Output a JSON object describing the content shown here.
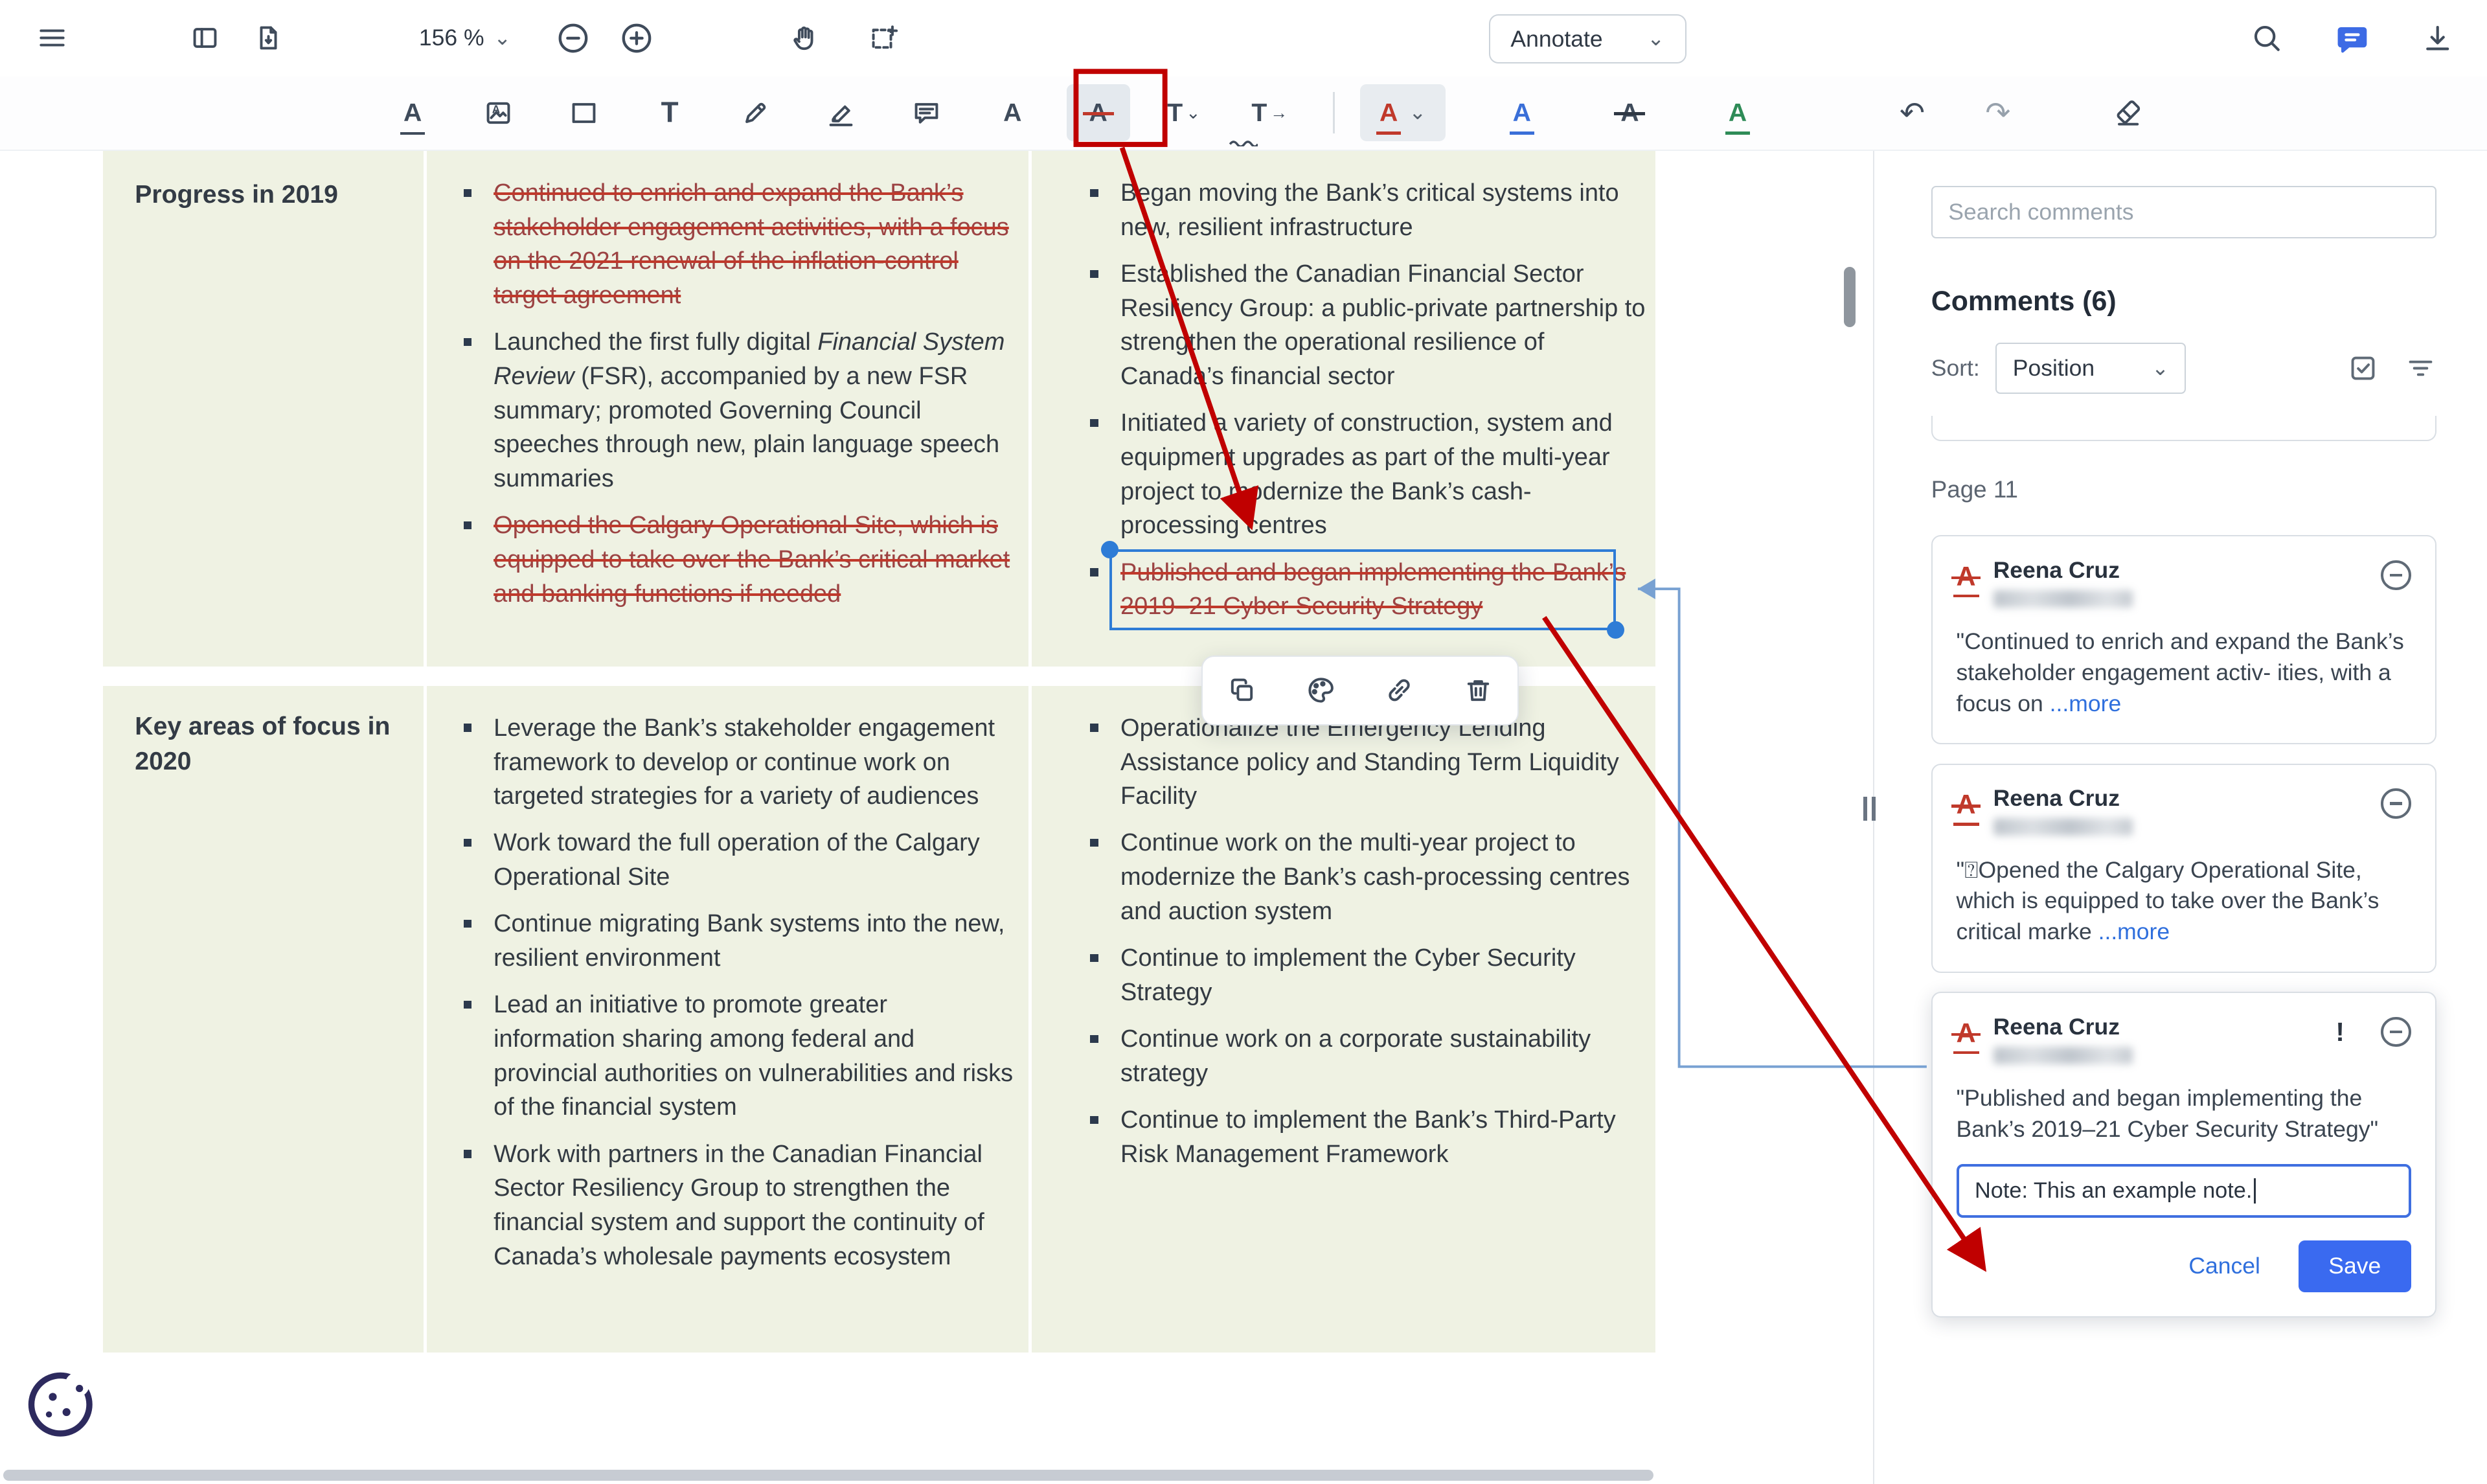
{
  "top_toolbar": {
    "zoom_value": "156 %",
    "annotate_label": "Annotate"
  },
  "glyphs": {
    "chevron": "⌄",
    "undo": "↶",
    "redo": "↷"
  },
  "tools": {
    "underline": "A",
    "text": "T",
    "squiggle": "A",
    "strikeout": "A",
    "insert_text": "T",
    "replace_text": "T",
    "style_red": "A",
    "style_blue": "A",
    "style_black": "A",
    "style_green": "A"
  },
  "doc": {
    "rows": [
      {
        "label": "Progress in 2019",
        "col1": [
          {
            "text": "Continued to enrich and expand the Bank’s stakeholder engagement activities, with a focus on the 2021 renewal of the inflation-control target agreement"
          },
          {
            "pre": "Launched the first fully digital ",
            "italic": "Financial System Review",
            "post": " (FSR), accompanied by a new FSR summary; promoted Governing Council speeches through new, plain language speech summaries"
          },
          {
            "text": "Opened the Calgary Operational Site, which is equipped to take over the Bank’s critical market and banking functions if needed"
          }
        ],
        "col2": [
          {
            "text": "Began moving the Bank’s critical systems into new, resilient infrastructure"
          },
          {
            "text": "Established the Canadian Financial Sector Resiliency Group: a public-private partnership to strengthen the operational resilience of Canada’s financial sector"
          },
          {
            "text": "Initiated a variety of construction, system and equipment upgrades as part of the multi-year project to modernize the Bank’s cash-processing centres"
          },
          {
            "text": "Published and began implementing the Bank’s 2019–21 Cyber Security Strategy"
          }
        ]
      },
      {
        "label": "Key areas of focus in 2020",
        "col1": [
          {
            "text": "Leverage the Bank’s stakeholder engagement framework to develop or continue work on targeted strategies for a variety of audiences"
          },
          {
            "text": "Work toward the full operation of the Calgary Operational Site"
          },
          {
            "text": "Continue migrating Bank systems into the new, resilient environment"
          },
          {
            "text": "Lead an initiative to promote greater information sharing among federal and provincial authorities on vulnerabilities and risks of the financial system"
          },
          {
            "text": "Work with partners in the Canadian Financial Sector Resiliency Group to strengthen the financial system and support the continuity of Canada’s wholesale payments ecosystem"
          }
        ],
        "col2": [
          {
            "text": "Operationalize the Emergency Lending Assistance policy and Standing Term Liquidity Facility"
          },
          {
            "text": "Continue work on the multi-year project to modernize the Bank’s cash-processing centres and auction system"
          },
          {
            "text": "Continue to implement the Cyber Security Strategy"
          },
          {
            "text": "Continue work on a corporate sustainability strategy"
          },
          {
            "text": "Continue to implement the Bank’s Third-Party Risk Management Framework"
          }
        ]
      }
    ]
  },
  "comments": {
    "search_placeholder": "Search comments",
    "title": "Comments",
    "count": "(6)",
    "sort_label": "Sort:",
    "sort_value": "Position",
    "page_label": "Page 11",
    "cards": [
      {
        "author": "Reena Cruz",
        "quote": "\"Continued to enrich and expand the Bank’s stakeholder engagement activ- ities, with a focus on ",
        "more": "...more"
      },
      {
        "author": "Reena Cruz",
        "quote": "\"⍰Opened the Calgary Operational Site, which is equipped to take over the Bank’s critical marke ",
        "more": "...more"
      },
      {
        "author": "Reena Cruz",
        "priority": "!",
        "quote": "\"Published and began implementing the Bank’s 2019–21 Cyber Security Strategy\"",
        "note_value": "Note: This an example note.",
        "cancel_label": "Cancel",
        "save_label": "Save"
      }
    ]
  },
  "colors": {
    "tutorial_red": "#c00000",
    "selection_blue": "#2e7cd6",
    "save_blue": "#3a6af0",
    "table_green": "#eff2e3",
    "strike_red": "#c0392b"
  }
}
